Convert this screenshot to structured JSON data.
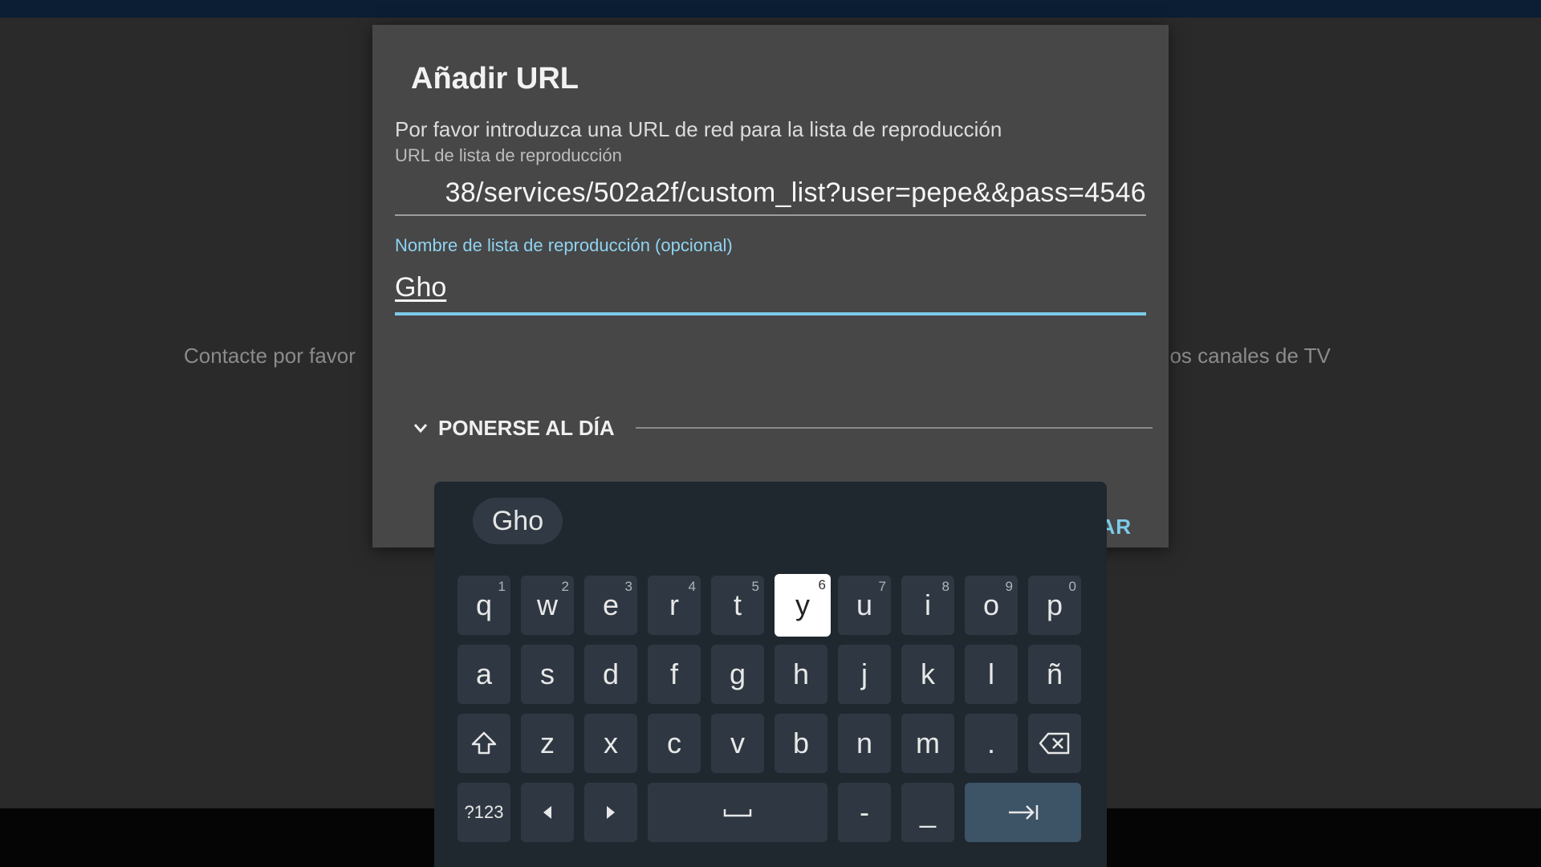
{
  "background": {
    "message_left": "Contacte por favor",
    "message_right": "n los canales de TV"
  },
  "dialog": {
    "title": "Añadir URL",
    "message": "Por favor introduzca una URL de red para la lista de reproducción",
    "url_label": "URL de lista de reproducción",
    "url_value": "38/services/502a2f/custom_list?user=pepe&&pass=4546",
    "name_label": "Nombre de lista de reproducción (opcional)",
    "name_value": "Gho",
    "section_label": "PONERSE AL DÍA",
    "button_partial": "AR",
    "colors": {
      "accent": "#7ccbe8",
      "dialog_bg": "#474747"
    }
  },
  "keyboard": {
    "suggestion": "Gho",
    "row1": [
      {
        "label": "q",
        "hint": "1"
      },
      {
        "label": "w",
        "hint": "2"
      },
      {
        "label": "e",
        "hint": "3"
      },
      {
        "label": "r",
        "hint": "4"
      },
      {
        "label": "t",
        "hint": "5"
      },
      {
        "label": "y",
        "hint": "6"
      },
      {
        "label": "u",
        "hint": "7"
      },
      {
        "label": "i",
        "hint": "8"
      },
      {
        "label": "o",
        "hint": "9"
      },
      {
        "label": "p",
        "hint": "0"
      }
    ],
    "row2": [
      "a",
      "s",
      "d",
      "f",
      "g",
      "h",
      "j",
      "k",
      "l",
      "ñ"
    ],
    "row3": [
      "z",
      "x",
      "c",
      "v",
      "b",
      "n",
      "m",
      "."
    ],
    "symbols_label": "?123",
    "dash_label": "-",
    "underscore_label": "_",
    "focused_key": "y",
    "icons": {
      "shift": "shift-icon",
      "backspace": "backspace-icon",
      "left": "arrow-left-icon",
      "right": "arrow-right-icon",
      "space": "space-icon",
      "next": "tab-next-icon"
    }
  }
}
